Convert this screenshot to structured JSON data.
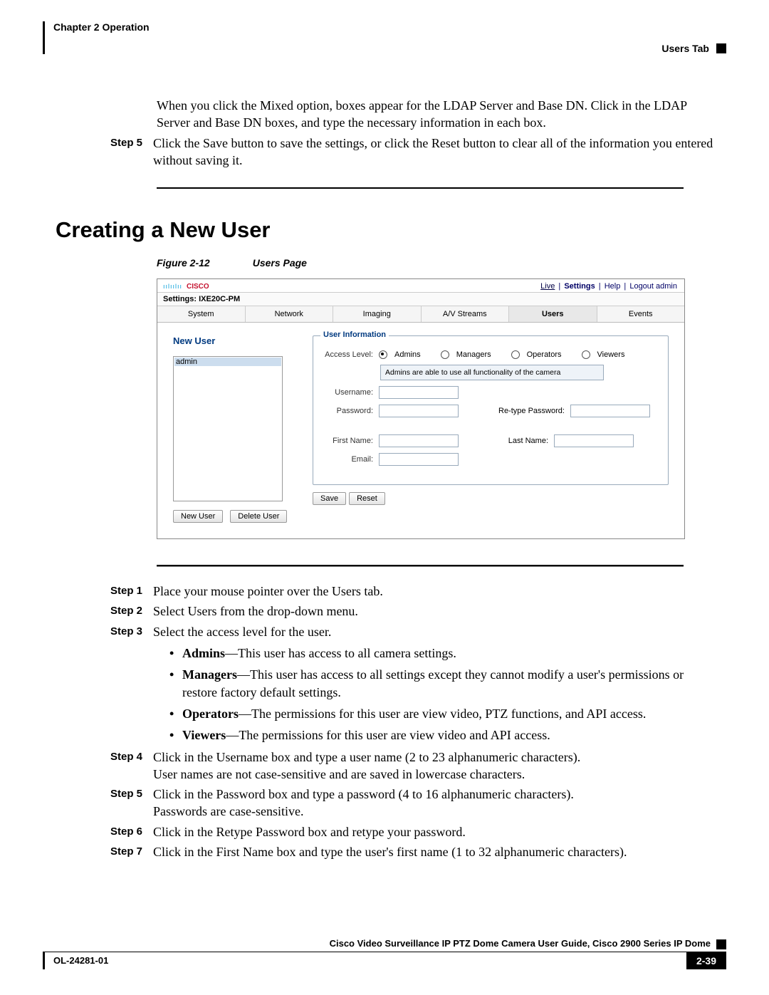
{
  "header": {
    "chapter": "Chapter 2    Operation",
    "tabname": "Users Tab"
  },
  "intro_para": "When you click the Mixed option, boxes appear for the LDAP Server and Base DN. Click in the LDAP Server and Base DN boxes, and type the necessary information in each box.",
  "pre_step5_label": "Step 5",
  "pre_step5_text": "Click the Save button to save the settings, or click the Reset button to clear all of the information you entered without saving it.",
  "section_heading": "Creating a New User",
  "figure_label": "Figure 2-12",
  "figure_title": "Users Page",
  "shot": {
    "cisco": "CISCO",
    "toplinks": {
      "live": "Live",
      "settings": "Settings",
      "help": "Help",
      "logout": "Logout admin"
    },
    "settings_line": "Settings: IXE20C-PM",
    "tabs": [
      "System",
      "Network",
      "Imaging",
      "A/V Streams",
      "Users",
      "Events"
    ],
    "newuser": "New User",
    "listitem": "admin",
    "btn_new": "New User",
    "btn_del": "Delete User",
    "legend": "User Information",
    "access": "Access Level:",
    "roles": [
      "Admins",
      "Managers",
      "Operators",
      "Viewers"
    ],
    "desc": "Admins are able to use all functionality of the camera",
    "username": "Username:",
    "password": "Password:",
    "repass": "Re-type Password:",
    "first": "First Name:",
    "last": "Last Name:",
    "email": "Email:",
    "save": "Save",
    "reset": "Reset"
  },
  "steps": {
    "s1l": "Step 1",
    "s1": "Place your mouse pointer over the Users tab.",
    "s2l": "Step 2",
    "s2": "Select Users from the drop-down menu.",
    "s3l": "Step 3",
    "s3": "Select the access level for the user.",
    "b_admins_h": "Admins",
    "b_admins": "—This user has access to all camera settings.",
    "b_mgr_h": "Managers",
    "b_mgr": "—This user has access to all settings except they cannot modify a user's permissions or restore factory default settings.",
    "b_ops_h": "Operators",
    "b_ops": "—The permissions for this user are view video, PTZ functions, and API access.",
    "b_view_h": "Viewers",
    "b_view": "—The permissions for this user are view video and API access.",
    "s4l": "Step 4",
    "s4a": "Click in the Username box and type a user name (2 to 23 alphanumeric characters).",
    "s4b": "User names are not case-sensitive and are saved in lowercase characters.",
    "s5l": "Step 5",
    "s5a": "Click in the Password box and type a password (4 to 16 alphanumeric characters).",
    "s5b": "Passwords are case-sensitive.",
    "s6l": "Step 6",
    "s6": "Click in the Retype Password box and retype your password.",
    "s7l": "Step 7",
    "s7": "Click in the First Name box and type the user's first name (1 to 32 alphanumeric characters)."
  },
  "footer": {
    "title": "Cisco Video Surveillance IP PTZ Dome Camera User Guide, Cisco 2900 Series IP Dome",
    "docnum": "OL-24281-01",
    "pagenum": "2-39"
  }
}
